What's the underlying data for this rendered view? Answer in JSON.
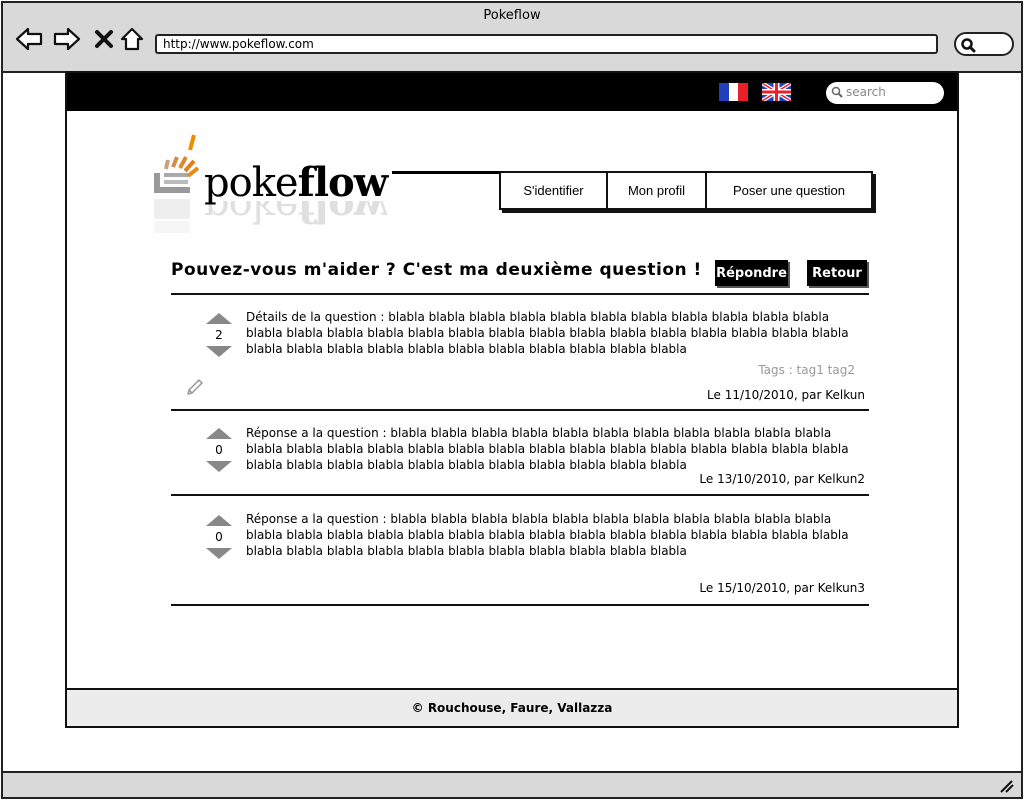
{
  "browser": {
    "window_title": "Pokeflow",
    "url": "http://www.pokeflow.com",
    "nav_icons": [
      "back-icon",
      "forward-icon",
      "stop-icon",
      "home-icon"
    ]
  },
  "header": {
    "search_placeholder": "search",
    "languages": [
      "fr",
      "en"
    ]
  },
  "logo": {
    "text_light": "poke",
    "text_bold": "flow"
  },
  "menu": {
    "login": "S'identifier",
    "profile": "Mon profil",
    "ask": "Poser une question"
  },
  "question": {
    "title": "Pouvez-vous m'aider ? C'est ma deuxième question !",
    "reply_button": "Répondre",
    "back_button": "Retour",
    "score": "2",
    "body": "Détails de la question : blabla blabla blabla blabla blabla blabla blabla blabla blabla blabla blabla blabla blabla blabla blabla blabla blabla blabla blabla blabla blabla blabla blabla blabla blabla blabla blabla blabla blabla blabla blabla blabla blabla blabla blabla blabla blabla",
    "tags": "Tags : tag1 tag2",
    "meta": "Le 11/10/2010, par Kelkun"
  },
  "answers": [
    {
      "score": "0",
      "body": "Réponse a la question : blabla blabla blabla blabla blabla blabla blabla blabla blabla blabla blabla blabla blabla blabla blabla blabla blabla blabla blabla blabla blabla blabla blabla blabla blabla blabla blabla blabla blabla blabla blabla blabla blabla blabla blabla blabla blabla",
      "meta": "Le 13/10/2010, par Kelkun2"
    },
    {
      "score": "0",
      "body": "Réponse a la question : blabla blabla blabla blabla blabla blabla blabla blabla blabla blabla blabla blabla blabla blabla blabla blabla blabla blabla blabla blabla blabla blabla blabla blabla blabla blabla blabla blabla blabla blabla blabla blabla blabla blabla blabla blabla blabla",
      "meta": "Le 15/10/2010, par Kelkun3"
    }
  ],
  "footer": {
    "copyright": "© Rouchouse, Faure, Vallazza"
  },
  "colors": {
    "topbar": "#000000",
    "vote_arrow": "#888888",
    "logo_accent": "#e8891c",
    "flag_blue": "#1f3fbf",
    "flag_red": "#e8212b"
  }
}
